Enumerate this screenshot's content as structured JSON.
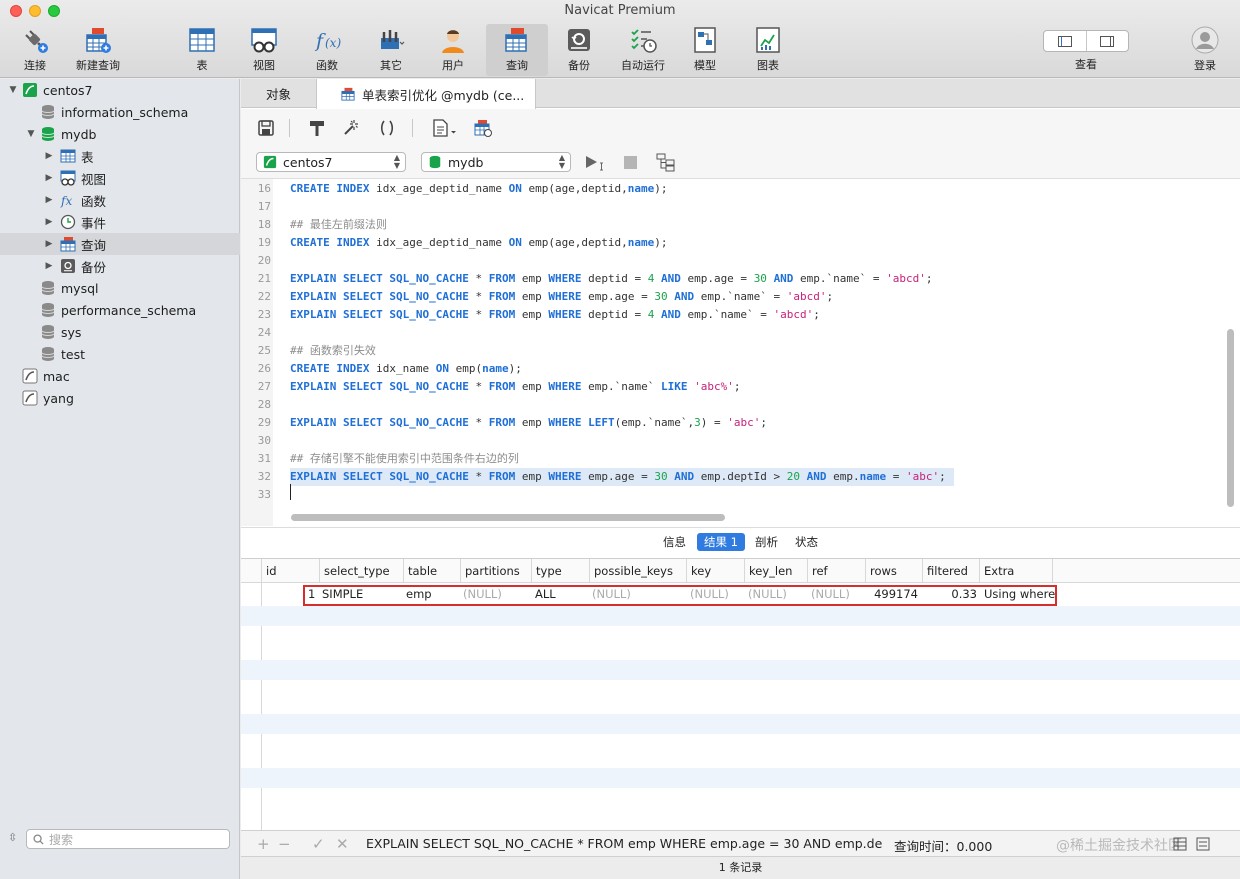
{
  "window": {
    "title": "Navicat Premium"
  },
  "toolbar": {
    "buttons": [
      {
        "label": "连接",
        "icon": "plug-icon"
      },
      {
        "label": "新建查询",
        "icon": "new-query-icon"
      },
      {
        "label": "表",
        "icon": "table-icon"
      },
      {
        "label": "视图",
        "icon": "view-icon"
      },
      {
        "label": "函数",
        "icon": "function-icon"
      },
      {
        "label": "其它",
        "icon": "tools-icon"
      },
      {
        "label": "用户",
        "icon": "user-icon"
      },
      {
        "label": "查询",
        "icon": "query-icon"
      },
      {
        "label": "备份",
        "icon": "backup-icon"
      },
      {
        "label": "自动运行",
        "icon": "auto-run-icon"
      },
      {
        "label": "模型",
        "icon": "model-icon"
      },
      {
        "label": "图表",
        "icon": "chart-icon"
      }
    ],
    "view_label": "查看",
    "login_label": "登录",
    "active": "查询"
  },
  "sidebar": {
    "items": [
      {
        "label": "centos7",
        "level": 0,
        "arrow": "▼"
      },
      {
        "label": "information_schema",
        "level": 1,
        "arrow": ""
      },
      {
        "label": "mydb",
        "level": 1,
        "arrow": "▼"
      },
      {
        "label": "表",
        "level": 2,
        "arrow": "▶"
      },
      {
        "label": "视图",
        "level": 2,
        "arrow": "▶"
      },
      {
        "label": "函数",
        "level": 2,
        "arrow": "▶"
      },
      {
        "label": "事件",
        "level": 2,
        "arrow": "▶"
      },
      {
        "label": "查询",
        "level": 2,
        "arrow": "▶"
      },
      {
        "label": "备份",
        "level": 2,
        "arrow": "▶"
      },
      {
        "label": "mysql",
        "level": 1,
        "arrow": ""
      },
      {
        "label": "performance_schema",
        "level": 1,
        "arrow": ""
      },
      {
        "label": "sys",
        "level": 1,
        "arrow": ""
      },
      {
        "label": "test",
        "level": 1,
        "arrow": ""
      },
      {
        "label": "mac",
        "level": 0,
        "arrow": ""
      },
      {
        "label": "yang",
        "level": 0,
        "arrow": ""
      }
    ],
    "search_placeholder": "搜索"
  },
  "tabs": {
    "objects_label": "对象",
    "query_label": "单表索引优化 @mydb (ce..."
  },
  "selectors": {
    "connection": "centos7",
    "database": "mydb"
  },
  "editor": {
    "lines": [
      {
        "n": "16",
        "text": "CREATE INDEX idx_age_deptid_name ON emp(age,deptid,name);"
      },
      {
        "n": "17",
        "text": ""
      },
      {
        "n": "18",
        "text": "## 最佳左前缀法则"
      },
      {
        "n": "19",
        "text": "CREATE INDEX idx_age_deptid_name ON emp(age,deptid,name);"
      },
      {
        "n": "20",
        "text": ""
      },
      {
        "n": "21",
        "text": "EXPLAIN SELECT SQL_NO_CACHE * FROM emp WHERE deptid = 4 AND emp.age = 30 AND emp.`name` = 'abcd';"
      },
      {
        "n": "22",
        "text": "EXPLAIN SELECT SQL_NO_CACHE * FROM emp WHERE emp.age = 30 AND emp.`name` = 'abcd';"
      },
      {
        "n": "23",
        "text": "EXPLAIN SELECT SQL_NO_CACHE * FROM emp WHERE deptid = 4 AND emp.`name` = 'abcd';"
      },
      {
        "n": "24",
        "text": ""
      },
      {
        "n": "25",
        "text": "## 函数索引失效"
      },
      {
        "n": "26",
        "text": "CREATE INDEX idx_name ON emp(name);"
      },
      {
        "n": "27",
        "text": "EXPLAIN SELECT SQL_NO_CACHE * FROM emp WHERE emp.`name` LIKE 'abc%';"
      },
      {
        "n": "28",
        "text": ""
      },
      {
        "n": "29",
        "text": "EXPLAIN SELECT SQL_NO_CACHE * FROM emp WHERE LEFT(emp.`name`,3) = 'abc';"
      },
      {
        "n": "30",
        "text": ""
      },
      {
        "n": "31",
        "text": "## 存储引擎不能使用索引中范围条件右边的列"
      },
      {
        "n": "32",
        "text": "EXPLAIN SELECT SQL_NO_CACHE * FROM emp WHERE emp.age = 30 AND emp.deptId > 20 AND emp.name = 'abc';"
      },
      {
        "n": "33",
        "text": ""
      }
    ],
    "highlighted_line": "32"
  },
  "result_tabs": [
    "信息",
    "结果 1",
    "剖析",
    "状态"
  ],
  "result_active": "结果 1",
  "grid": {
    "columns": [
      "id",
      "select_type",
      "table",
      "partitions",
      "type",
      "possible_keys",
      "key",
      "key_len",
      "ref",
      "rows",
      "filtered",
      "Extra"
    ],
    "rows": [
      {
        "id": "1",
        "select_type": "SIMPLE",
        "table": "emp",
        "partitions": "(NULL)",
        "type": "ALL",
        "possible_keys": "(NULL)",
        "key": "(NULL)",
        "key_len": "(NULL)",
        "ref": "(NULL)",
        "rows": "499174",
        "filtered": "0.33",
        "Extra": "Using where"
      }
    ]
  },
  "footer": {
    "sql": "EXPLAIN SELECT SQL_NO_CACHE * FROM emp WHERE emp.age = 30 AND emp.de...",
    "query_time": "查询时间：0.000",
    "watermark": "@稀土掘金技术社区",
    "record_count": "1 条记录"
  },
  "colors": {
    "accent": "#2f7be0",
    "keyword": "#1f6fd6",
    "number": "#1aa34a",
    "string": "#c8217a",
    "highlight_box": "#d62d2d"
  }
}
